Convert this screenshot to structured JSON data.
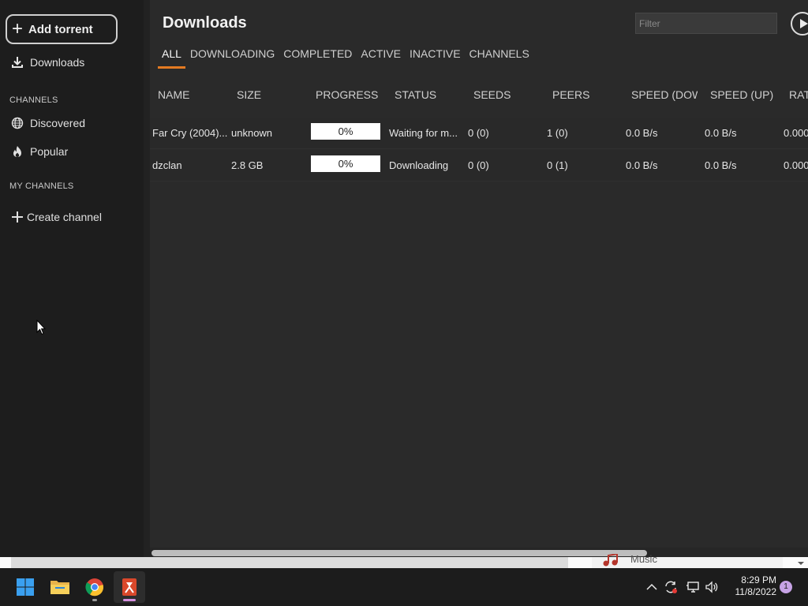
{
  "sidebar": {
    "add_torrent_label": "Add torrent",
    "downloads_label": "Downloads",
    "channels_heading": "CHANNELS",
    "discovered_label": "Discovered",
    "popular_label": "Popular",
    "my_channels_heading": "MY CHANNELS",
    "create_channel_label": "Create channel"
  },
  "main": {
    "title": "Downloads",
    "filter_placeholder": "Filter",
    "tabs": [
      {
        "label": "ALL",
        "active": true
      },
      {
        "label": "DOWNLOADING"
      },
      {
        "label": "COMPLETED"
      },
      {
        "label": "ACTIVE"
      },
      {
        "label": "INACTIVE"
      },
      {
        "label": "CHANNELS"
      }
    ],
    "columns": [
      "NAME",
      "SIZE",
      "PROGRESS",
      "STATUS",
      "SEEDS",
      "PEERS",
      "SPEED (DOW",
      "SPEED (UP)",
      "RAT"
    ],
    "rows": [
      {
        "name": "Far Cry (2004)...",
        "size": "unknown",
        "progress": "0%",
        "status": "Waiting for m...",
        "seeds": "0 (0)",
        "peers": "1 (0)",
        "speed_down": "0.0 B/s",
        "speed_up": "0.0 B/s",
        "ratio": "0.000"
      },
      {
        "name": "dzclan",
        "size": "2.8 GB",
        "progress": "0%",
        "status": "Downloading",
        "seeds": "0 (0)",
        "peers": "0 (1)",
        "speed_down": "0.0 B/s",
        "speed_up": "0.0 B/s",
        "ratio": "0.000"
      }
    ]
  },
  "background": {
    "music_label": "Music"
  },
  "taskbar": {
    "apps": [
      "windows-start",
      "file-explorer",
      "chrome",
      "tribler"
    ],
    "time": "8:29 PM",
    "date": "11/8/2022",
    "notification_count": "1"
  },
  "colors": {
    "accent": "#e47a22",
    "sidebar_bg": "#1d1d1d",
    "main_bg": "#2a2a2a",
    "taskbar_bg": "#1c1c1c"
  }
}
